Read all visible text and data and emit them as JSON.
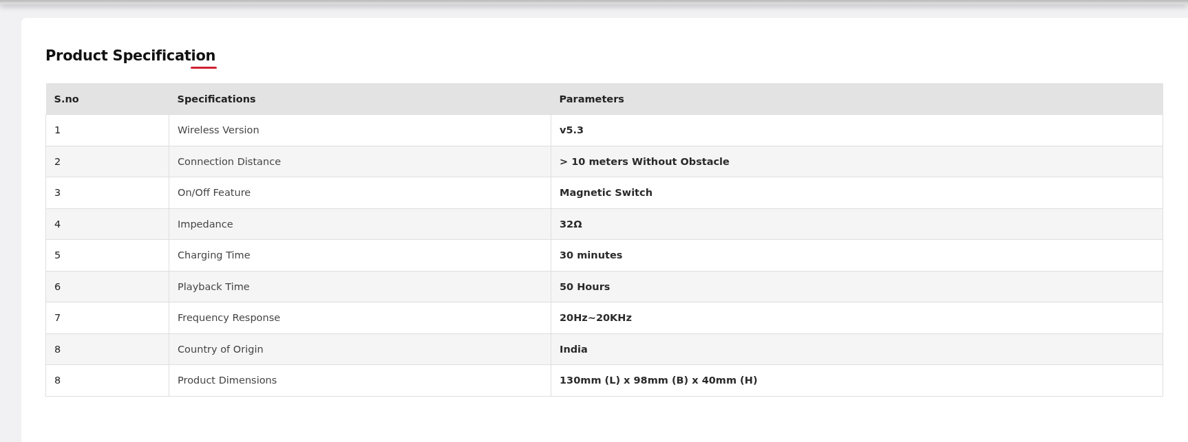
{
  "heading": "Product Specification",
  "table": {
    "columns": [
      "S.no",
      "Specifications",
      "Parameters"
    ],
    "rows": [
      {
        "sno": "1",
        "specification": "Wireless Version",
        "parameter": "v5.3"
      },
      {
        "sno": "2",
        "specification": "Connection Distance",
        "parameter": "> 10 meters Without Obstacle"
      },
      {
        "sno": "3",
        "specification": "On/Off Feature",
        "parameter": "Magnetic Switch"
      },
      {
        "sno": "4",
        "specification": "Impedance",
        "parameter": "32Ω"
      },
      {
        "sno": "5",
        "specification": "Charging Time",
        "parameter": "30 minutes"
      },
      {
        "sno": "6",
        "specification": "Playback Time",
        "parameter": "50 Hours"
      },
      {
        "sno": "7",
        "specification": "Frequency Response",
        "parameter": "20Hz~20KHz"
      },
      {
        "sno": "8",
        "specification": "Country of Origin",
        "parameter": "India"
      },
      {
        "sno": "8",
        "specification": "Product Dimensions",
        "parameter": "130mm (L) x 98mm (B) x 40mm (H)"
      }
    ]
  }
}
